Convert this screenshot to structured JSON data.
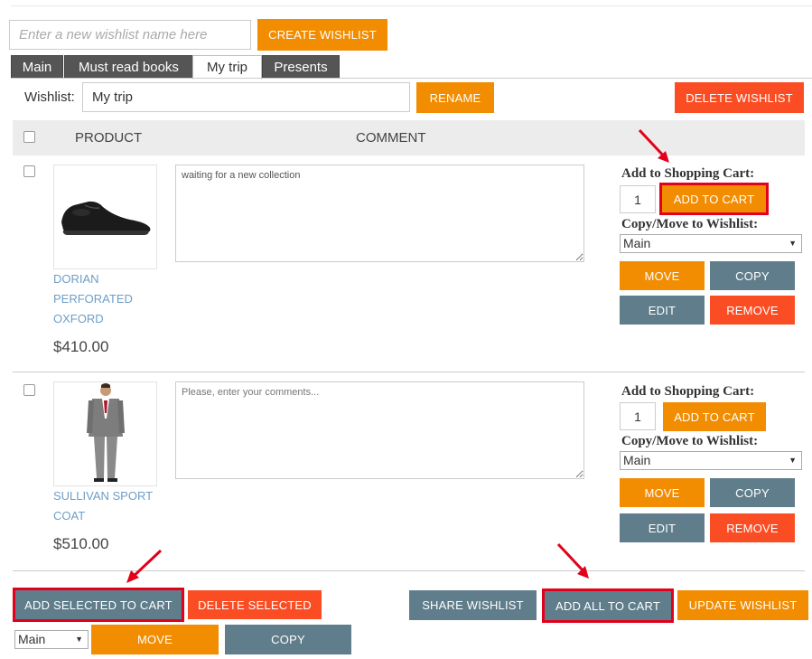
{
  "create": {
    "placeholder": "Enter a new wishlist name here",
    "button_label": "CREATE WISHLIST"
  },
  "tabs": [
    "Main",
    "Must read books",
    "My trip",
    "Presents"
  ],
  "active_tab": "My trip",
  "wishlist": {
    "label": "Wishlist:",
    "name": "My trip",
    "rename_label": "RENAME",
    "delete_label": "DELETE WISHLIST"
  },
  "table": {
    "col_product": "PRODUCT",
    "col_comment": "COMMENT"
  },
  "item_labels": {
    "add_to_cart_heading": "Add to Shopping Cart:",
    "add_to_cart_button": "ADD TO CART",
    "copy_move_heading": "Copy/Move to Wishlist:",
    "move": "MOVE",
    "copy": "COPY",
    "edit": "EDIT",
    "remove": "REMOVE"
  },
  "items": [
    {
      "name": "DORIAN PERFORATED OXFORD",
      "name_lines": [
        "DORIAN",
        "PERFORATED",
        "OXFORD"
      ],
      "price": "$410.00",
      "comment": "waiting for a new collection",
      "comment_placeholder": "Please, enter your comments...",
      "quantity": "1",
      "target_wishlist": "Main"
    },
    {
      "name": "SULLIVAN SPORT COAT",
      "name_lines": [
        "SULLIVAN SPORT",
        "COAT"
      ],
      "price": "$510.00",
      "comment": "",
      "comment_placeholder": "Please, enter your comments...",
      "quantity": "1",
      "target_wishlist": "Main"
    }
  ],
  "footer": {
    "add_selected": "ADD SELECTED TO CART",
    "delete_selected": "DELETE SELECTED",
    "share": "SHARE WISHLIST",
    "add_all": "ADD ALL TO CART",
    "update": "UPDATE WISHLIST",
    "target_wishlist": "Main",
    "move": "MOVE",
    "copy": "COPY"
  },
  "colors": {
    "orange": "#f28c00",
    "red": "#fb4d24",
    "slate": "#607d8b",
    "link": "#6e9ec6",
    "highlight": "#e2001a"
  },
  "icons": [
    "shoe-image",
    "suit-image",
    "arrow-icon",
    "chevron-down-icon",
    "checkbox-icon"
  ]
}
